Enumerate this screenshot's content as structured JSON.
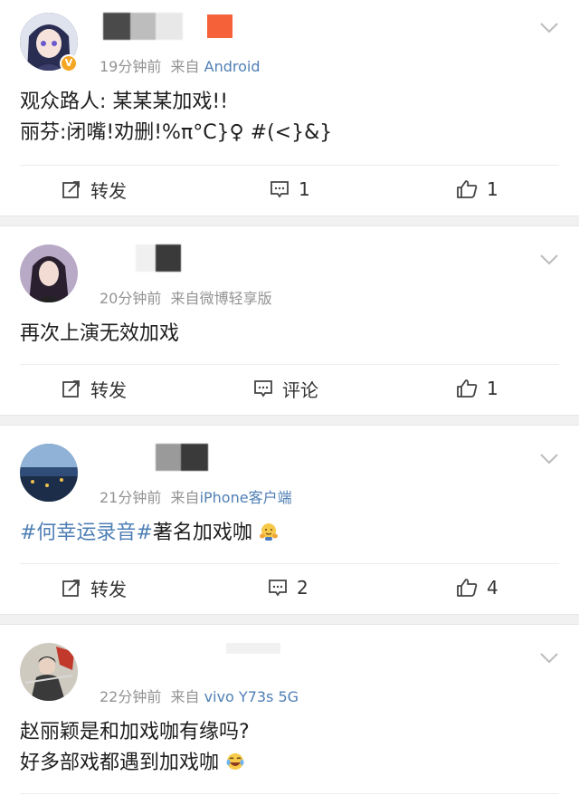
{
  "posts": [
    {
      "time": "19分钟前",
      "source_prefix": "来自",
      "source": "Android",
      "lines": [
        "观众路人: 某某某加戏!!",
        "丽芬:闭嘴!劝删!%π°C}♀ #(<}&}"
      ],
      "actions": {
        "repost": "转发",
        "comment": "1",
        "like": "1"
      }
    },
    {
      "time": "20分钟前",
      "source_prefix": "来自",
      "source": "微博轻享版",
      "lines": [
        "再次上演无效加戏"
      ],
      "actions": {
        "repost": "转发",
        "comment": "评论",
        "like": "1"
      }
    },
    {
      "time": "21分钟前",
      "source_prefix": "来自",
      "source": "iPhone客户端",
      "topic": "#何幸运录音#",
      "rest": "著名加戏咖",
      "actions": {
        "repost": "转发",
        "comment": "2",
        "like": "4"
      }
    },
    {
      "time": "22分钟前",
      "source_prefix": "来自",
      "source": "vivo Y73s 5G",
      "lines": [
        "赵丽颖是和加戏咖有缘吗?",
        "好多部戏都遇到加戏咖"
      ],
      "actions": {}
    }
  ],
  "icons": [
    "verified-badge-icon",
    "chevron-down-icon",
    "repost-icon",
    "comment-icon",
    "like-icon",
    "hug-emoji-icon",
    "laugh-cry-emoji-icon"
  ],
  "colors": {
    "link": "#4f7fb5",
    "meta": "#939393",
    "separator": "#f1f1f1",
    "badge": "#f5a623"
  }
}
